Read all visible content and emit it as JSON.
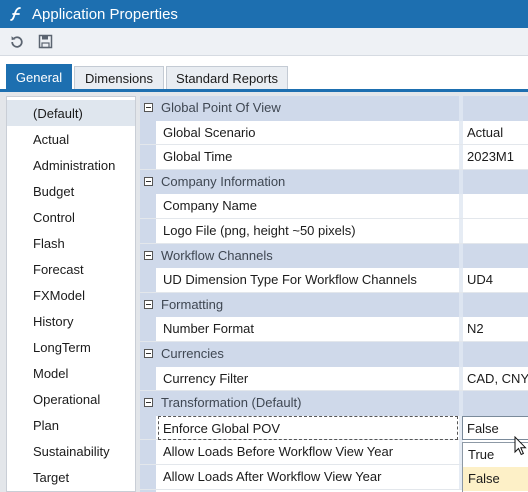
{
  "window": {
    "title": "Application Properties",
    "logo_icon": "app-logo-icon"
  },
  "toolbar": {
    "buttons": [
      {
        "icon": "refresh-icon"
      },
      {
        "icon": "save-icon"
      }
    ]
  },
  "tabs": [
    {
      "label": "General",
      "active": true
    },
    {
      "label": "Dimensions",
      "active": false
    },
    {
      "label": "Standard Reports",
      "active": false
    }
  ],
  "tree": {
    "items": [
      {
        "label": "(Default)",
        "selected": true
      },
      {
        "label": "Actual"
      },
      {
        "label": "Administration"
      },
      {
        "label": "Budget"
      },
      {
        "label": "Control"
      },
      {
        "label": "Flash"
      },
      {
        "label": "Forecast"
      },
      {
        "label": "FXModel"
      },
      {
        "label": "History"
      },
      {
        "label": "LongTerm"
      },
      {
        "label": "Model"
      },
      {
        "label": "Operational"
      },
      {
        "label": "Plan"
      },
      {
        "label": "Sustainability"
      },
      {
        "label": "Target"
      }
    ]
  },
  "grid": {
    "rows": [
      {
        "kind": "category",
        "label": "Global Point Of View"
      },
      {
        "kind": "property",
        "name": "Global Scenario",
        "value": "Actual"
      },
      {
        "kind": "property",
        "name": "Global Time",
        "value": "2023M1"
      },
      {
        "kind": "category",
        "label": "Company Information"
      },
      {
        "kind": "property",
        "name": "Company Name",
        "value": ""
      },
      {
        "kind": "property",
        "name": "Logo File (png, height ~50 pixels)",
        "value": ""
      },
      {
        "kind": "category",
        "label": "Workflow Channels"
      },
      {
        "kind": "property",
        "name": "UD Dimension Type For Workflow Channels",
        "value": "UD4"
      },
      {
        "kind": "category",
        "label": "Formatting"
      },
      {
        "kind": "property",
        "name": "Number Format",
        "value": "N2"
      },
      {
        "kind": "category",
        "label": "Currencies"
      },
      {
        "kind": "property",
        "name": "Currency Filter",
        "value": "CAD, CNY, EUR"
      },
      {
        "kind": "category",
        "label": "Transformation (Default)"
      },
      {
        "kind": "property",
        "name": "Enforce Global POV",
        "value": "False",
        "focused": true,
        "editing": true
      },
      {
        "kind": "property",
        "name": "Allow Loads Before Workflow View Year",
        "value": ""
      },
      {
        "kind": "property",
        "name": "Allow Loads After Workflow View Year",
        "value": ""
      }
    ]
  },
  "dropdown": {
    "options": [
      {
        "label": "True",
        "hover": false
      },
      {
        "label": "False",
        "hover": true
      }
    ]
  },
  "colors": {
    "accent": "#1d6fb0",
    "category_band": "#cfd9ea",
    "hover": "#fdf0c7"
  }
}
